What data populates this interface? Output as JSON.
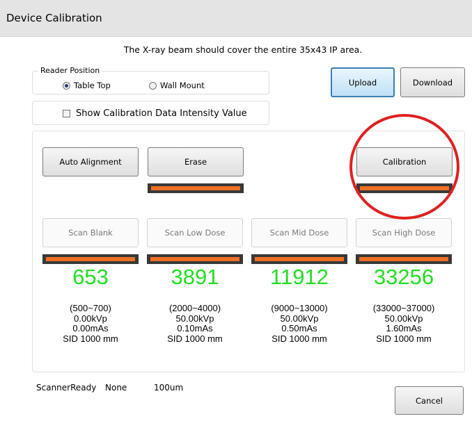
{
  "window": {
    "title": "Device Calibration"
  },
  "instruction": "The X-ray beam should cover the entire  35x43 IP area.",
  "reader_position": {
    "legend": "Reader Position",
    "options": [
      {
        "label": "Table Top",
        "selected": true
      },
      {
        "label": "Wall Mount",
        "selected": false
      }
    ]
  },
  "show_intensity": {
    "label": "Show Calibration Data Intensity Value",
    "checked": false
  },
  "buttons": {
    "upload": "Upload",
    "download": "Download",
    "auto_alignment": "Auto Alignment",
    "erase": "Erase",
    "calibration": "Calibration",
    "cancel": "Cancel"
  },
  "scans": [
    {
      "button": "Scan Blank",
      "value": "653",
      "range": "(500~700)",
      "kvp": "0.00kVp",
      "mas": "0.00mAs",
      "sid": "SID 1000 mm",
      "progress": 1.0
    },
    {
      "button": "Scan Low Dose",
      "value": "3891",
      "range": "(2000~4000)",
      "kvp": "50.00kVp",
      "mas": "0.10mAs",
      "sid": "SID 1000 mm",
      "progress": 1.0
    },
    {
      "button": "Scan Mid Dose",
      "value": "11912",
      "range": "(9000~13000)",
      "kvp": "50.00kVp",
      "mas": "0.50mAs",
      "sid": "SID 1000 mm",
      "progress": 1.0
    },
    {
      "button": "Scan High Dose",
      "value": "33256",
      "range": "(33000~37000)",
      "kvp": "50.00kVp",
      "mas": "1.60mAs",
      "sid": "SID 1000 mm",
      "progress": 1.0
    }
  ],
  "erase_progress": 1.0,
  "calibration_progress": 1.0,
  "status": {
    "state": "ScannerReady",
    "detail": "None",
    "resolution": "100um"
  },
  "colors": {
    "value_text": "#22dd22",
    "progress_fill": "#ee7022",
    "highlight_circle": "#e02020"
  }
}
